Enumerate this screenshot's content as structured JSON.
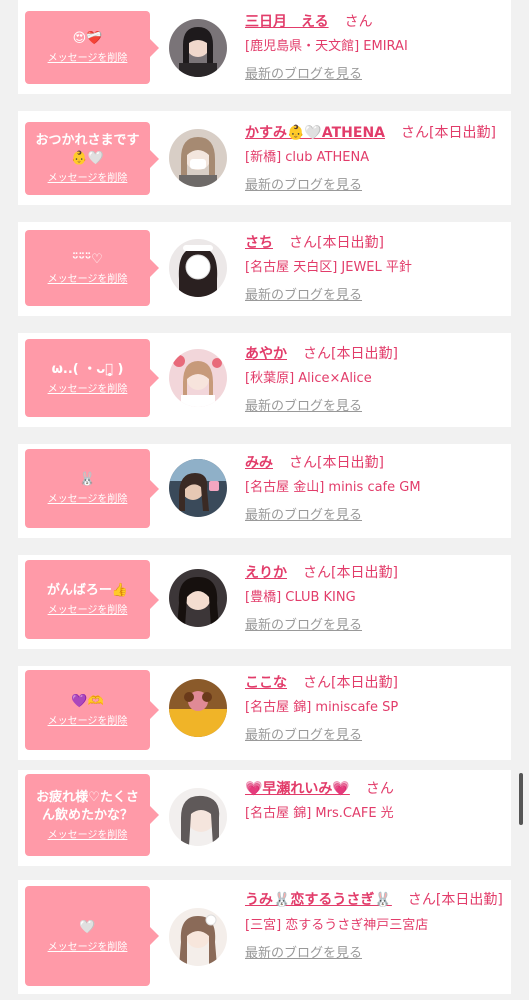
{
  "colors": {
    "accent": "#e23c6a",
    "bubble": "#ff9aa8",
    "muted": "#999999"
  },
  "items": [
    {
      "message": "😍❤️‍🩹",
      "delete_label": "メッセージを削除",
      "name": "三日月　える",
      "san": "さん",
      "tag": "",
      "shop": "[鹿児島県・天文館] EMIRAI",
      "blog_label": "最新のブログを見る",
      "avatar_icon": "avatar-photo"
    },
    {
      "message": "おつかれさまです👶🤍",
      "delete_label": "メッセージを削除",
      "name": "かすみ👶🤍ATHENA",
      "san": "さん",
      "tag": "[本日出勤]",
      "shop": "[新橋] club ATHENA",
      "blog_label": "最新のブログを見る",
      "avatar_icon": "avatar-photo"
    },
    {
      "message": "ᵕ̈ᵕ̈ᵕ̈♡",
      "delete_label": "メッセージを削除",
      "name": "さち",
      "san": "さん",
      "tag": "[本日出勤]",
      "shop": "[名古屋 天白区] JEWEL 平針",
      "blog_label": "最新のブログを見る",
      "avatar_icon": "avatar-photo"
    },
    {
      "message": "ω..( ・ᴗ・̥̥̥ )",
      "delete_label": "メッセージを削除",
      "name": "あやか",
      "san": "さん",
      "tag": "[本日出勤]",
      "shop": "[秋葉原] Alice×Alice",
      "blog_label": "最新のブログを見る",
      "avatar_icon": "avatar-photo"
    },
    {
      "message": "🐰",
      "delete_label": "メッセージを削除",
      "name": "みみ",
      "san": "さん",
      "tag": "[本日出勤]",
      "shop": "[名古屋 金山] minis cafe GM",
      "blog_label": "最新のブログを見る",
      "avatar_icon": "avatar-photo"
    },
    {
      "message": "がんばろー👍",
      "delete_label": "メッセージを削除",
      "name": "えりか",
      "san": "さん",
      "tag": "[本日出勤]",
      "shop": "[豊橋] CLUB KING",
      "blog_label": "最新のブログを見る",
      "avatar_icon": "avatar-photo"
    },
    {
      "message": "💜🫶",
      "delete_label": "メッセージを削除",
      "name": "ここな",
      "san": "さん",
      "tag": "[本日出勤]",
      "shop": "[名古屋 錦] miniscafe SP",
      "blog_label": "最新のブログを見る",
      "avatar_icon": "avatar-photo"
    },
    {
      "message": "お疲れ様♡たくさん飲めたかな？",
      "delete_label": "メッセージを削除",
      "name": "💗早瀬れいみ💗",
      "san": "さん",
      "tag": "",
      "shop": "[名古屋 錦] Mrs.CAFE 光",
      "blog_label": "",
      "avatar_icon": "avatar-photo"
    },
    {
      "message": "🤍",
      "delete_label": "メッセージを削除",
      "name": "うみ🐰恋するうさぎ🐰",
      "san": "さん",
      "tag": "[本日出勤]",
      "shop": "[三宮] 恋するうさぎ神戸三宮店",
      "blog_label": "最新のブログを見る",
      "avatar_icon": "avatar-photo"
    }
  ]
}
